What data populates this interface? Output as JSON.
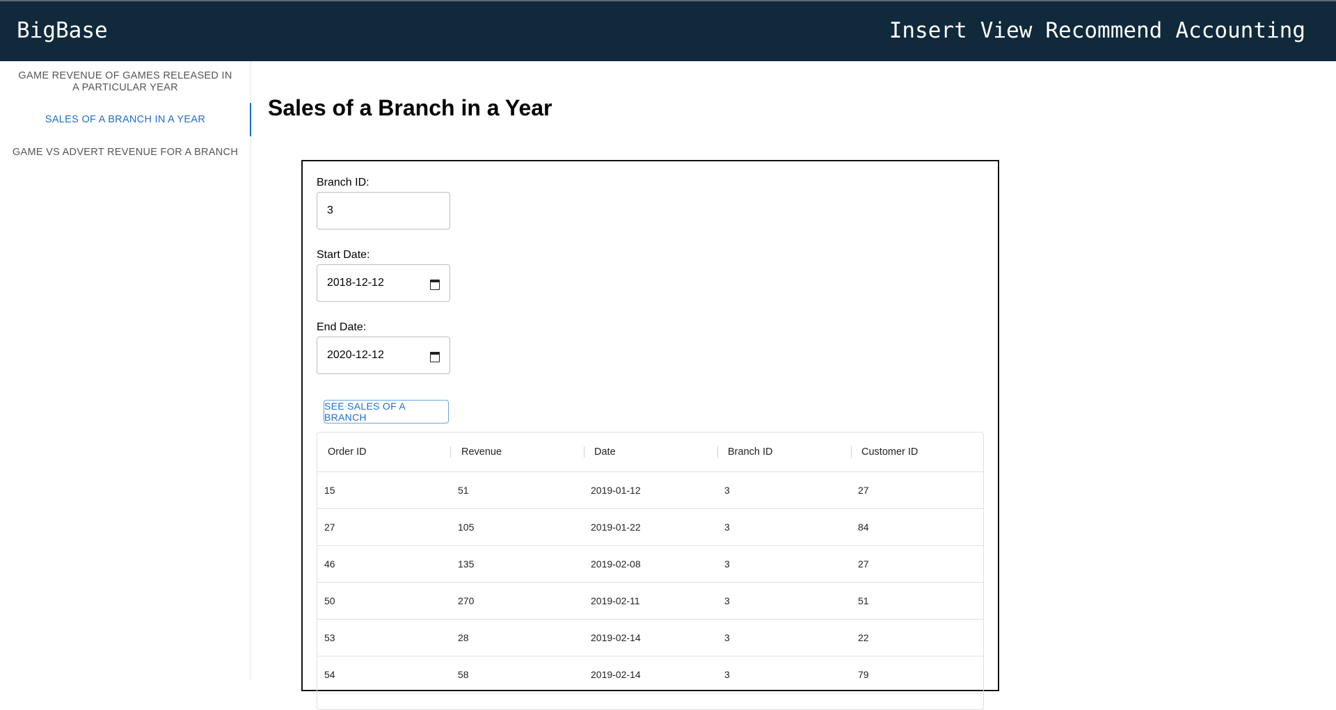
{
  "header": {
    "brand": "BigBase",
    "nav": [
      "Insert",
      "View",
      "Recommend",
      "Accounting"
    ]
  },
  "sidebar": {
    "items": [
      {
        "label": "GAME REVENUE OF GAMES RELEASED IN A PARTICULAR YEAR",
        "active": false
      },
      {
        "label": "SALES OF A BRANCH IN A YEAR",
        "active": true
      },
      {
        "label": "GAME VS ADVERT REVENUE FOR A BRANCH",
        "active": false
      }
    ]
  },
  "main": {
    "title": "Sales of a Branch in a Year",
    "form": {
      "branch_id_label": "Branch ID:",
      "branch_id_value": "3",
      "start_date_label": "Start Date:",
      "start_date_value": "2018-12-12",
      "end_date_label": "End Date:",
      "end_date_value": "2020-12-12",
      "submit_label": "SEE SALES OF A BRANCH"
    },
    "table": {
      "columns": [
        "Order ID",
        "Revenue",
        "Date",
        "Branch ID",
        "Customer ID"
      ],
      "rows": [
        [
          "15",
          "51",
          "2019-01-12",
          "3",
          "27"
        ],
        [
          "27",
          "105",
          "2019-01-22",
          "3",
          "84"
        ],
        [
          "46",
          "135",
          "2019-02-08",
          "3",
          "27"
        ],
        [
          "50",
          "270",
          "2019-02-11",
          "3",
          "51"
        ],
        [
          "53",
          "28",
          "2019-02-14",
          "3",
          "22"
        ],
        [
          "54",
          "58",
          "2019-02-14",
          "3",
          "79"
        ]
      ]
    }
  }
}
